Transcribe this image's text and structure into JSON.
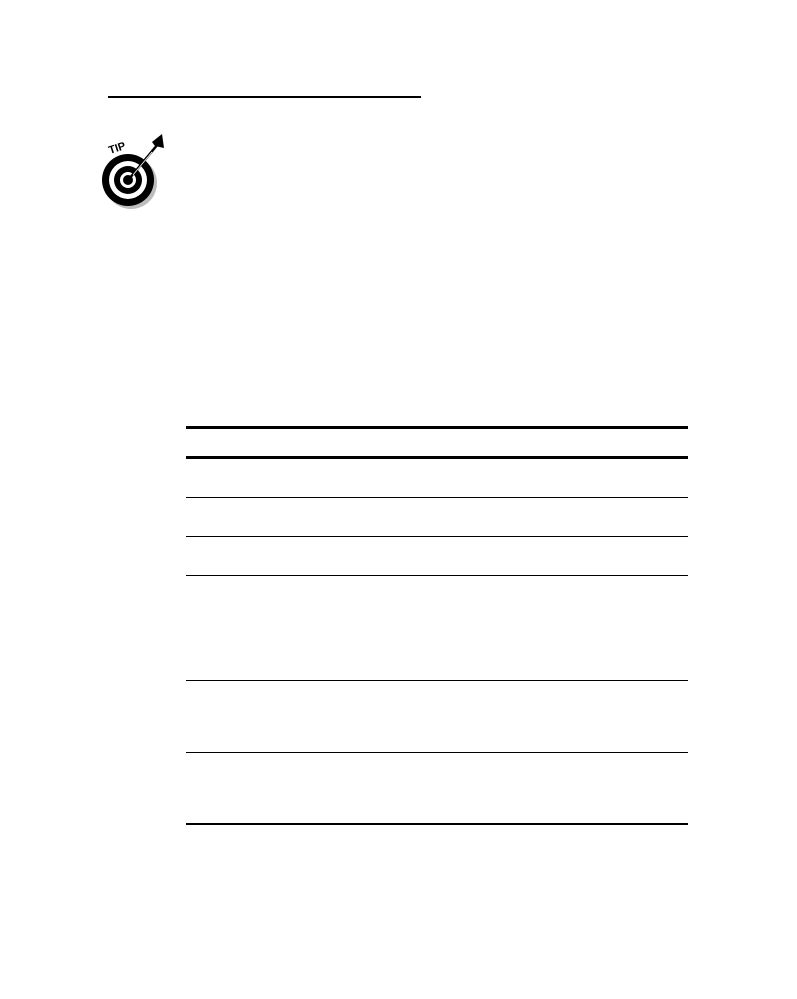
{
  "tip_icon": {
    "label": "TIP",
    "icon": "target-with-dart-icon"
  },
  "table": {
    "columns": [],
    "rows": [
      {
        "cells": []
      },
      {
        "cells": []
      },
      {
        "cells": []
      },
      {
        "cells": []
      },
      {
        "cells": []
      },
      {
        "cells": []
      }
    ]
  }
}
